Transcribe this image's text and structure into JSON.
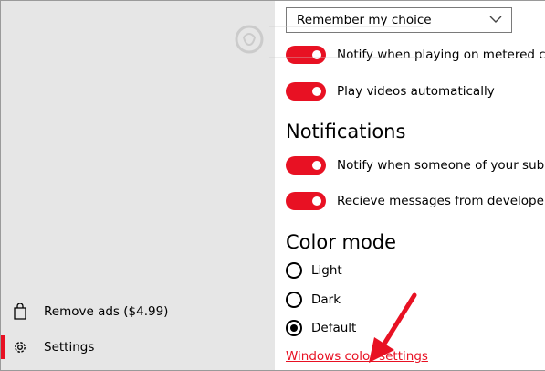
{
  "sidebar": {
    "items": [
      {
        "label": "Remove ads ($4.99)",
        "icon": "shopping-bag-icon"
      },
      {
        "label": "Settings",
        "icon": "gear-icon"
      }
    ]
  },
  "main": {
    "dropdown_value": "Remember my choice",
    "toggles_top": [
      {
        "label": "Notify when playing on metered connection",
        "on": true
      },
      {
        "label": "Play videos automatically",
        "on": true
      }
    ],
    "notifications_heading": "Notifications",
    "toggles_notifications": [
      {
        "label": "Notify when someone of your subscriptions",
        "on": true
      },
      {
        "label": "Recieve messages from developers",
        "on": true
      }
    ],
    "color_mode_heading": "Color mode",
    "color_options": [
      "Light",
      "Dark",
      "Default"
    ],
    "color_selected": "Default",
    "windows_link": "Windows color settings"
  },
  "colors": {
    "accent": "#e81123",
    "sidebar_bg": "#e6e6e6"
  }
}
